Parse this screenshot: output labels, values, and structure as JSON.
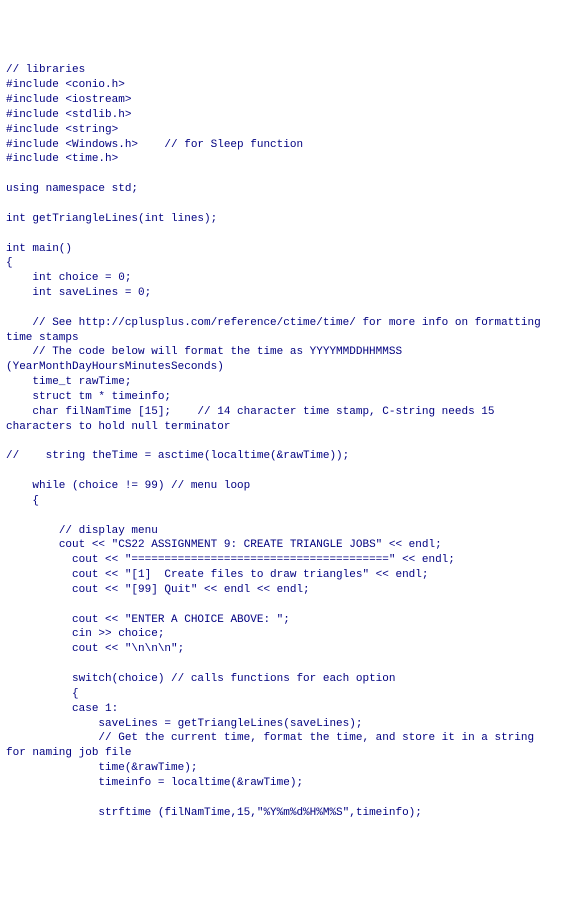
{
  "code": {
    "lines": [
      "// libraries",
      "#include <conio.h>",
      "#include <iostream>",
      "#include <stdlib.h>",
      "#include <string>",
      "#include <Windows.h>    // for Sleep function",
      "#include <time.h>",
      "",
      "using namespace std;",
      "",
      "int getTriangleLines(int lines);",
      "",
      "int main()",
      "{",
      "    int choice = 0;",
      "    int saveLines = 0;",
      "",
      "    // See http://cplusplus.com/reference/ctime/time/ for more info on formatting time stamps",
      "    // The code below will format the time as YYYYMMDDHHMMSS (YearMonthDayHoursMinutesSeconds)",
      "    time_t rawTime;",
      "    struct tm * timeinfo;",
      "    char filNamTime [15];    // 14 character time stamp, C-string needs 15 characters to hold null terminator",
      "",
      "//    string theTime = asctime(localtime(&rawTime));",
      "",
      "    while (choice != 99) // menu loop",
      "    {",
      "",
      "        // display menu",
      "        cout << \"CS22 ASSIGNMENT 9: CREATE TRIANGLE JOBS\" << endl;",
      "          cout << \"=======================================\" << endl;",
      "          cout << \"[1]  Create files to draw triangles\" << endl;",
      "          cout << \"[99] Quit\" << endl << endl;",
      "",
      "          cout << \"ENTER A CHOICE ABOVE: \";",
      "          cin >> choice;",
      "          cout << \"\\n\\n\\n\";",
      "",
      "          switch(choice) // calls functions for each option",
      "          {",
      "          case 1:",
      "              saveLines = getTriangleLines(saveLines);",
      "              // Get the current time, format the time, and store it in a string for naming job file",
      "              time(&rawTime);",
      "              timeinfo = localtime(&rawTime);",
      "",
      "              strftime (filNamTime,15,\"%Y%m%d%H%M%S\",timeinfo);"
    ]
  }
}
